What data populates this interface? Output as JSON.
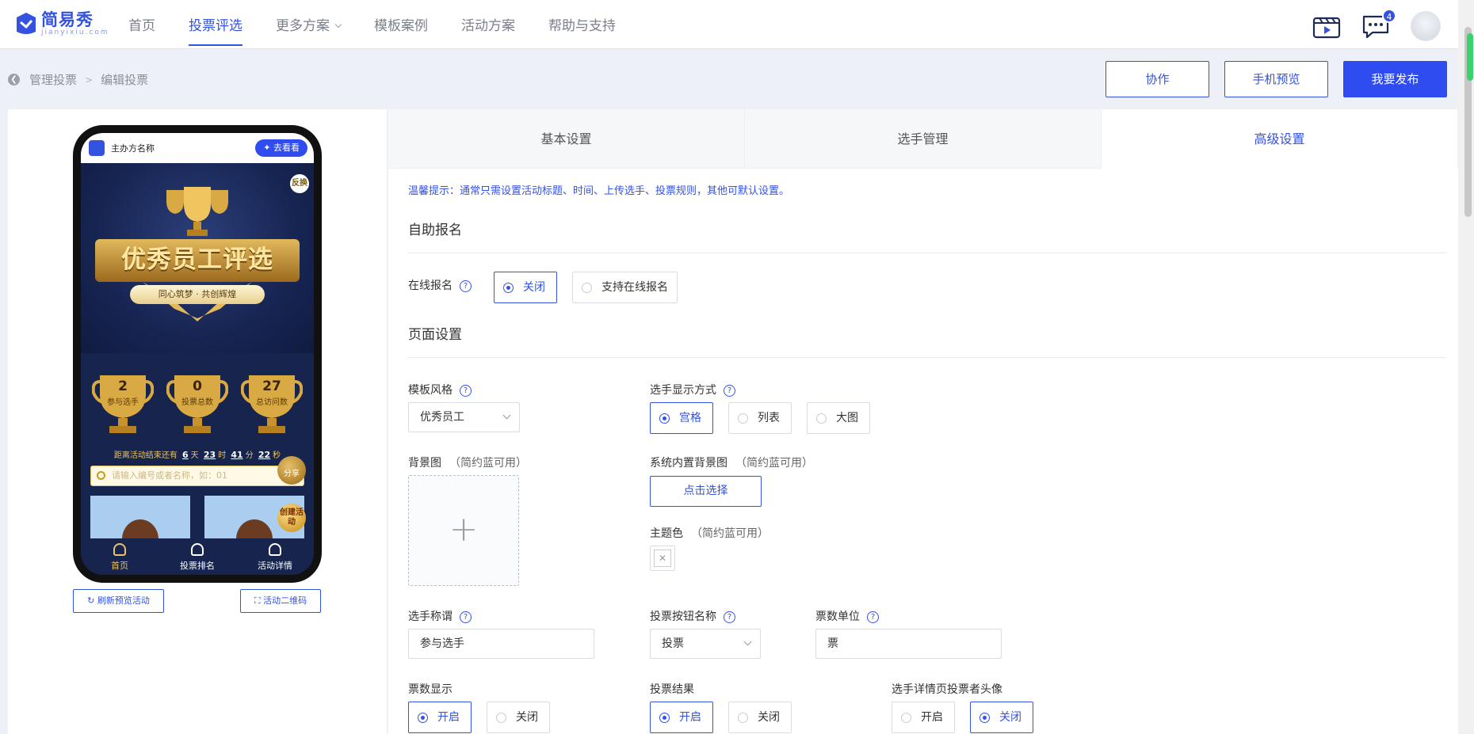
{
  "brand": {
    "name": "简易秀",
    "sub": "jianyixiu.com"
  },
  "nav": [
    {
      "label": "首页"
    },
    {
      "label": "投票评选",
      "active": true
    },
    {
      "label": "更多方案",
      "dropdown": true
    },
    {
      "label": "模板案例"
    },
    {
      "label": "活动方案"
    },
    {
      "label": "帮助与支持"
    }
  ],
  "top_icons": {
    "video": "video-icon",
    "message": "message-icon",
    "message_count": "4"
  },
  "breadcrumb": {
    "parent": "管理投票",
    "current": "编辑投票"
  },
  "actions": {
    "collab": "协作",
    "preview": "手机预览",
    "publish": "我要发布"
  },
  "phone": {
    "org_name": "主办方名称",
    "go_label": "去看看",
    "swap_label": "反换",
    "title": "优秀员工评选",
    "subtitle": "同心筑梦 · 共创辉煌",
    "stats": [
      {
        "num": "2",
        "label": "参与选手"
      },
      {
        "num": "0",
        "label": "投票总数"
      },
      {
        "num": "27",
        "label": "总访问数"
      }
    ],
    "countdown": {
      "prefix": "距离活动结束还有",
      "days": "6",
      "days_unit": "天",
      "hours": "23",
      "hours_unit": "时",
      "minutes": "41",
      "minutes_unit": "分",
      "seconds": "22",
      "seconds_unit": "秒"
    },
    "search_placeholder": "请输入编号或者名称，如：01",
    "share_label": "分享",
    "create_label": "创建活动",
    "tabs": [
      {
        "label": "首页"
      },
      {
        "label": "投票排名"
      },
      {
        "label": "活动详情"
      }
    ]
  },
  "preview_buttons": {
    "refresh": "刷新预览活动",
    "qrcode": "活动二维码"
  },
  "tabs": [
    {
      "label": "基本设置"
    },
    {
      "label": "选手管理"
    },
    {
      "label": "高级设置",
      "active": true
    }
  ],
  "tip": "温馨提示：通常只需设置活动标题、时间、上传选手、投票规则，其他可默认设置。",
  "self_signup": {
    "section": "自助报名",
    "label": "在线报名",
    "options": [
      "关闭",
      "支持在线报名"
    ],
    "selected": 0
  },
  "page_settings": {
    "section": "页面设置",
    "template_style": {
      "label": "模板风格",
      "value": "优秀员工"
    },
    "display_mode": {
      "label": "选手显示方式",
      "options": [
        "宫格",
        "列表",
        "大图"
      ],
      "selected": 0
    },
    "bg_image": {
      "label": "背景图",
      "note": "（简约蓝可用）"
    },
    "builtin_bg": {
      "label": "系统内置背景图",
      "note": "（简约蓝可用）",
      "button": "点击选择"
    },
    "theme_color": {
      "label": "主题色",
      "note": "（简约蓝可用）"
    },
    "player_title": {
      "label": "选手称谓",
      "value": "参与选手"
    },
    "vote_button": {
      "label": "投票按钮名称",
      "value": "投票"
    },
    "vote_unit": {
      "label": "票数单位",
      "value": "票"
    },
    "vote_count_display": {
      "label": "票数显示",
      "options": [
        "开启",
        "关闭"
      ],
      "selected": 0
    },
    "vote_result": {
      "label": "投票结果",
      "options": [
        "开启",
        "关闭"
      ],
      "selected": 0
    },
    "voter_avatar": {
      "label": "选手详情页投票者头像",
      "options": [
        "开启",
        "关闭"
      ],
      "selected": 1
    }
  },
  "colors": {
    "accent": "#3452e0",
    "primary_button": "#2f4cf0",
    "phone_bg": "#17254e",
    "gold": "#e7c26a"
  }
}
